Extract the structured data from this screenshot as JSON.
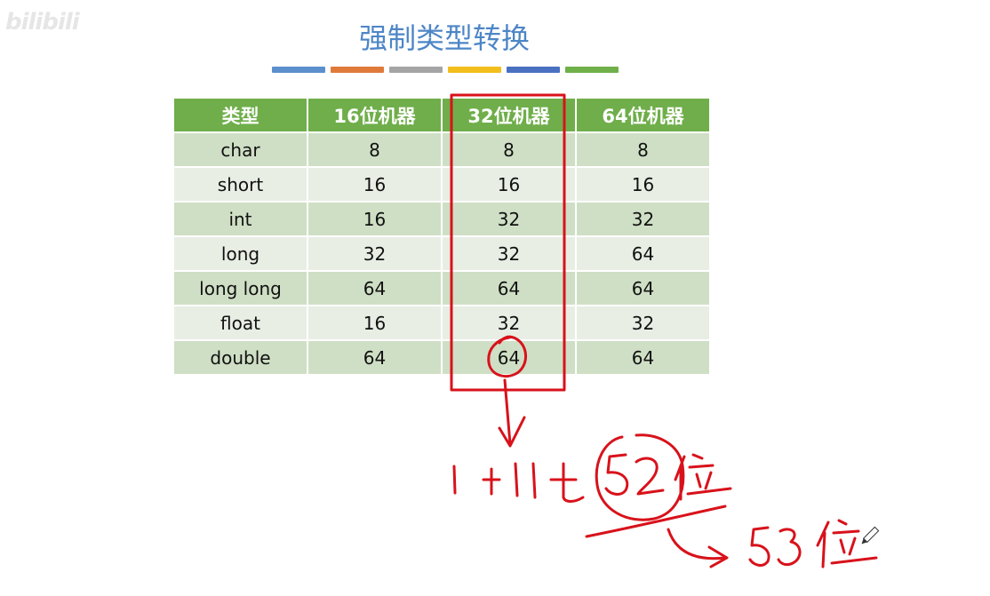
{
  "watermark": "bilibili",
  "title": "强制类型转换",
  "color_bars": [
    "#5b8fcd",
    "#e07a3b",
    "#a5a5a5",
    "#f2be1b",
    "#4a70c2",
    "#6fb04a"
  ],
  "table": {
    "headers": [
      "类型",
      "16位机器",
      "32位机器",
      "64位机器"
    ],
    "rows": [
      [
        "char",
        "8",
        "8",
        "8"
      ],
      [
        "short",
        "16",
        "16",
        "16"
      ],
      [
        "int",
        "16",
        "32",
        "32"
      ],
      [
        "long",
        "32",
        "32",
        "64"
      ],
      [
        "long long",
        "64",
        "64",
        "64"
      ],
      [
        "float",
        "16",
        "32",
        "32"
      ],
      [
        "double",
        "64",
        "64",
        "64"
      ]
    ]
  },
  "annotation_color": "#d8121b"
}
